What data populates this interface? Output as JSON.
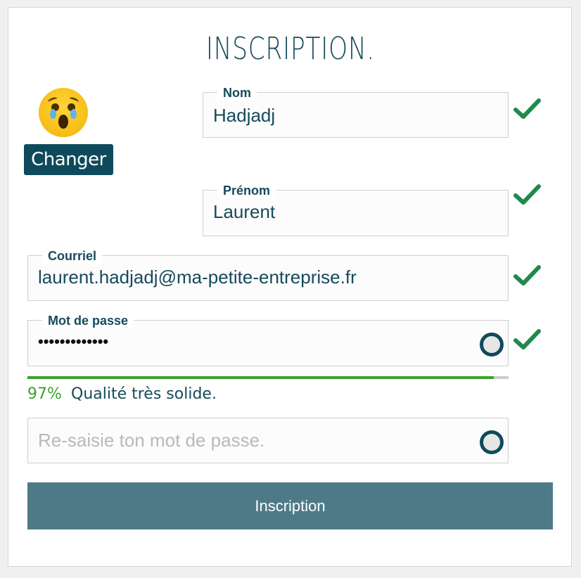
{
  "form": {
    "title": "INSCRIPTION.",
    "avatar_icon": "crying-face-emoji",
    "change_button_label": "Changer",
    "nom": {
      "label": "Nom",
      "value": "Hadjadj",
      "valid": true
    },
    "prenom": {
      "label": "Prénom",
      "value": "Laurent",
      "valid": true
    },
    "courriel": {
      "label": "Courriel",
      "value": "laurent.hadjadj@ma-petite-entreprise.fr",
      "valid": true
    },
    "password": {
      "label": "Mot de passe",
      "masked_value": "•••••••••••••",
      "valid": true,
      "toggle_icon": "eye-ring-icon"
    },
    "strength": {
      "percent": 97,
      "percent_text": "97%",
      "label": "Qualité très solide."
    },
    "confirm": {
      "placeholder": "Re-saisie ton mot de passe.",
      "toggle_icon": "eye-ring-icon"
    },
    "submit_label": "Inscription"
  },
  "colors": {
    "primary": "#0e4a5c",
    "check_green": "#1f8a4c",
    "strength_green": "#3aa22e",
    "submit_bg": "#4e7a88"
  }
}
